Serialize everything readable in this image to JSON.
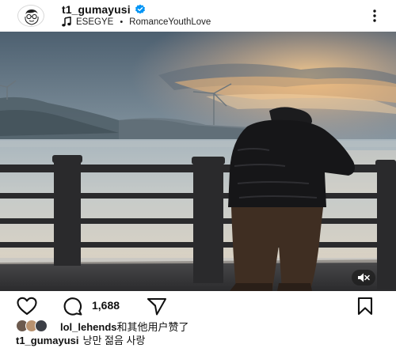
{
  "post": {
    "username": "t1_gumayusi",
    "music_artist": "ESEGYE",
    "music_separator": "•",
    "music_title": "RomanceYouthLove"
  },
  "actions": {
    "like_count": "1,688"
  },
  "likes": {
    "liker": "lol_lehends",
    "suffix": "和其他用户赞了"
  },
  "caption": {
    "username": "t1_gumayusi",
    "text": "낭만 젊음 사랑"
  },
  "icons": {
    "verified": "verified-badge-icon",
    "music": "music-note-icon",
    "more": "more-options-icon",
    "mute": "muted-speaker-icon",
    "like": "heart-icon",
    "comment": "comment-bubble-icon",
    "share": "paper-plane-icon",
    "save": "bookmark-icon"
  },
  "colors": {
    "verified_blue": "#0095f6",
    "text": "#111111"
  }
}
